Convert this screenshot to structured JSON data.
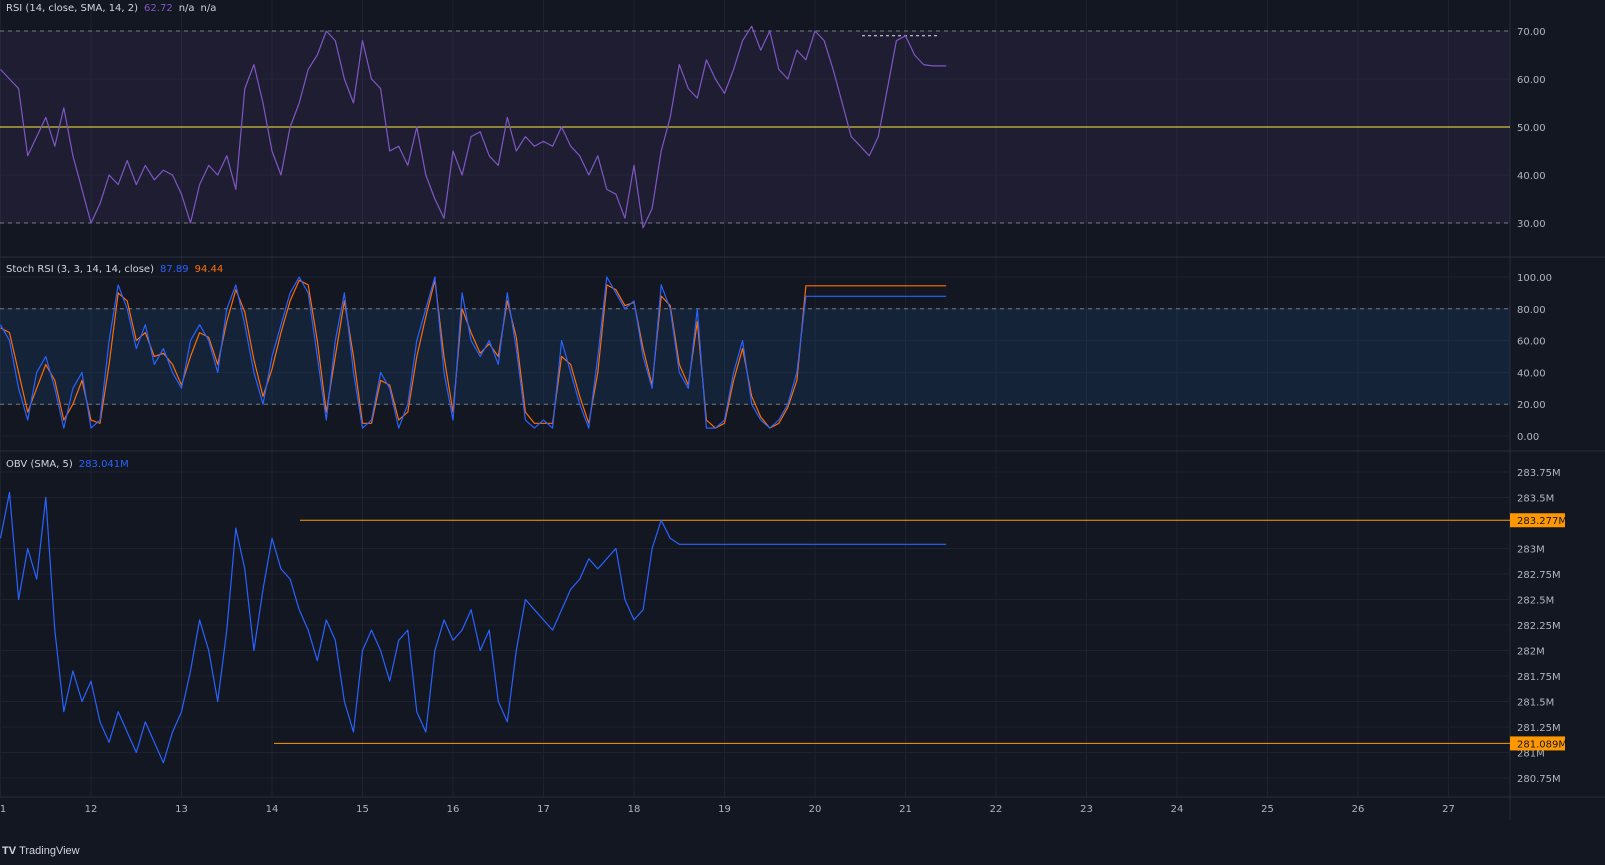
{
  "rsi": {
    "legend_name": "RSI (14, close, SMA, 14, 2)",
    "legend_value": "62.72",
    "legend_na1": "n/a",
    "legend_na2": "n/a",
    "ticks": [
      "70.00",
      "60.00",
      "50.00",
      "40.00",
      "30.00"
    ]
  },
  "stoch": {
    "legend_name": "Stoch RSI (3, 3, 14, 14, close)",
    "legend_k": "87.89",
    "legend_d": "94.44",
    "ticks": [
      "100.00",
      "80.00",
      "60.00",
      "40.00",
      "20.00",
      "0.00"
    ]
  },
  "obv": {
    "legend_name": "OBV (SMA, 5)",
    "legend_value": "283.041M",
    "ticks": [
      "283.75M",
      "283.5M",
      "283M",
      "282.75M",
      "282.5M",
      "282.25M",
      "282M",
      "281.75M",
      "281.5M",
      "281.25M",
      "281M",
      "280.75M"
    ],
    "level_high": "283.277M",
    "level_low": "281.089M"
  },
  "x_ticks": [
    "1",
    "12",
    "13",
    "14",
    "15",
    "16",
    "17",
    "18",
    "19",
    "20",
    "21",
    "22",
    "23",
    "24",
    "25",
    "26",
    "27"
  ],
  "brand": {
    "logo": "TV",
    "name": "TradingView"
  },
  "colors": {
    "background": "#131722",
    "rsi_line": "#7e57c2",
    "rsi_band": "#7e57c2",
    "rsi_mid_line": "#ffeb3b",
    "stoch_k": "#2962ff",
    "stoch_d": "#ff6d00",
    "stoch_band": "#2196f3",
    "obv_line": "#2962ff",
    "level_line": "#ff9800"
  },
  "chart_data": [
    {
      "type": "line",
      "title": "RSI (14, close, SMA, 14, 2)",
      "ylim": [
        27,
        73
      ],
      "guide_levels": [
        70,
        50,
        30
      ],
      "band": [
        30,
        70
      ],
      "x_range": [
        11,
        27.7
      ],
      "series": [
        {
          "name": "RSI",
          "x": [
            11.0,
            11.1,
            11.2,
            11.3,
            11.4,
            11.5,
            11.6,
            11.7,
            11.8,
            11.9,
            12.0,
            12.1,
            12.2,
            12.3,
            12.4,
            12.5,
            12.6,
            12.7,
            12.8,
            12.9,
            13.0,
            13.1,
            13.2,
            13.3,
            13.4,
            13.5,
            13.6,
            13.7,
            13.8,
            13.9,
            14.0,
            14.1,
            14.2,
            14.3,
            14.4,
            14.5,
            14.6,
            14.7,
            14.8,
            14.9,
            15.0,
            15.1,
            15.2,
            15.3,
            15.4,
            15.5,
            15.6,
            15.7,
            15.8,
            15.9,
            16.0,
            16.1,
            16.2,
            16.3,
            16.4,
            16.5,
            16.6,
            16.7,
            16.8,
            16.9,
            17.0,
            17.1,
            17.2,
            17.3,
            17.4,
            17.5,
            17.6,
            17.7,
            17.8,
            17.9,
            18.0,
            18.1,
            18.2,
            18.3,
            18.4,
            18.5,
            18.6,
            18.7,
            18.8,
            18.9,
            19.0,
            19.1,
            19.2,
            19.3,
            19.4,
            19.5,
            19.6,
            19.7,
            19.8,
            19.9,
            20.0,
            20.1,
            20.2,
            20.3,
            20.4,
            20.5,
            20.6,
            20.7,
            20.8,
            20.9,
            21.0,
            21.1,
            21.2,
            21.3,
            21.4,
            21.45
          ],
          "values": [
            62,
            60,
            58,
            44,
            48,
            52,
            46,
            54,
            44,
            37,
            30,
            34,
            40,
            38,
            43,
            38,
            42,
            39,
            41,
            40,
            36,
            30,
            38,
            42,
            40,
            44,
            37,
            58,
            63,
            55,
            45,
            40,
            50,
            55,
            62,
            65,
            70,
            68,
            60,
            55,
            68,
            60,
            58,
            45,
            46,
            42,
            50,
            40,
            35,
            31,
            45,
            40,
            48,
            49,
            44,
            42,
            52,
            45,
            48,
            46,
            47,
            46,
            50,
            46,
            44,
            40,
            44,
            37,
            36,
            31,
            42,
            29,
            33,
            45,
            52,
            63,
            58,
            56,
            64,
            60,
            57,
            62,
            68,
            71,
            66,
            70,
            62,
            60,
            66,
            64,
            70,
            68,
            62,
            55,
            48,
            46,
            44,
            48,
            58,
            68,
            69,
            65,
            63,
            62.72,
            62.72,
            62.72
          ]
        }
      ]
    },
    {
      "type": "line",
      "title": "Stoch RSI (3, 3, 14, 14, close)",
      "ylim": [
        -5,
        105
      ],
      "guide_levels": [
        80,
        20
      ],
      "band": [
        20,
        80
      ],
      "x_range": [
        11,
        27.7
      ],
      "series": [
        {
          "name": "K",
          "x": [
            11.0,
            11.1,
            11.2,
            11.3,
            11.4,
            11.5,
            11.6,
            11.7,
            11.8,
            11.9,
            12.0,
            12.1,
            12.2,
            12.3,
            12.4,
            12.5,
            12.6,
            12.7,
            12.8,
            12.9,
            13.0,
            13.1,
            13.2,
            13.3,
            13.4,
            13.5,
            13.6,
            13.7,
            13.8,
            13.9,
            14.0,
            14.1,
            14.2,
            14.3,
            14.4,
            14.5,
            14.6,
            14.7,
            14.8,
            14.9,
            15.0,
            15.1,
            15.2,
            15.3,
            15.4,
            15.5,
            15.6,
            15.7,
            15.8,
            15.9,
            16.0,
            16.1,
            16.2,
            16.3,
            16.4,
            16.5,
            16.6,
            16.7,
            16.8,
            16.9,
            17.0,
            17.1,
            17.2,
            17.3,
            17.4,
            17.5,
            17.6,
            17.7,
            17.8,
            17.9,
            18.0,
            18.1,
            18.2,
            18.3,
            18.4,
            18.5,
            18.6,
            18.7,
            18.8,
            18.9,
            19.0,
            19.1,
            19.2,
            19.3,
            19.4,
            19.5,
            19.6,
            19.7,
            19.8,
            19.9,
            20.0,
            20.1,
            20.2,
            20.3,
            20.4,
            20.5,
            20.6,
            20.7,
            20.8,
            20.9,
            21.0,
            21.1,
            21.2,
            21.3,
            21.4,
            21.45
          ],
          "values": [
            70,
            60,
            30,
            10,
            40,
            50,
            30,
            5,
            30,
            40,
            5,
            10,
            60,
            95,
            80,
            55,
            70,
            45,
            55,
            40,
            30,
            60,
            70,
            60,
            40,
            80,
            95,
            70,
            40,
            20,
            50,
            70,
            90,
            100,
            90,
            50,
            10,
            60,
            90,
            40,
            5,
            10,
            40,
            30,
            5,
            20,
            60,
            80,
            100,
            40,
            10,
            90,
            60,
            50,
            60,
            45,
            90,
            55,
            10,
            5,
            10,
            5,
            60,
            40,
            20,
            5,
            50,
            100,
            90,
            80,
            85,
            50,
            30,
            95,
            80,
            40,
            30,
            80,
            5,
            5,
            10,
            40,
            60,
            20,
            10,
            5,
            10,
            20,
            40,
            87.89,
            87.89,
            87.89,
            87.89,
            87.89,
            87.89,
            87.89,
            87.89,
            87.89,
            87.89,
            87.89,
            87.89,
            87.89,
            87.89,
            87.89,
            87.89,
            87.89
          ]
        },
        {
          "name": "D",
          "x": [
            11.0,
            11.1,
            11.2,
            11.3,
            11.4,
            11.5,
            11.6,
            11.7,
            11.8,
            11.9,
            12.0,
            12.1,
            12.2,
            12.3,
            12.4,
            12.5,
            12.6,
            12.7,
            12.8,
            12.9,
            13.0,
            13.1,
            13.2,
            13.3,
            13.4,
            13.5,
            13.6,
            13.7,
            13.8,
            13.9,
            14.0,
            14.1,
            14.2,
            14.3,
            14.4,
            14.5,
            14.6,
            14.7,
            14.8,
            14.9,
            15.0,
            15.1,
            15.2,
            15.3,
            15.4,
            15.5,
            15.6,
            15.7,
            15.8,
            15.9,
            16.0,
            16.1,
            16.2,
            16.3,
            16.4,
            16.5,
            16.6,
            16.7,
            16.8,
            16.9,
            17.0,
            17.1,
            17.2,
            17.3,
            17.4,
            17.5,
            17.6,
            17.7,
            17.8,
            17.9,
            18.0,
            18.1,
            18.2,
            18.3,
            18.4,
            18.5,
            18.6,
            18.7,
            18.8,
            18.9,
            19.0,
            19.1,
            19.2,
            19.3,
            19.4,
            19.5,
            19.6,
            19.7,
            19.8,
            19.9,
            20.0,
            20.1,
            20.2,
            20.3,
            20.4,
            20.5,
            20.6,
            20.7,
            20.8,
            20.9,
            21.0,
            21.1,
            21.2,
            21.3,
            21.4,
            21.45
          ],
          "values": [
            68,
            65,
            40,
            15,
            30,
            45,
            35,
            10,
            20,
            35,
            10,
            8,
            45,
            90,
            85,
            60,
            65,
            50,
            52,
            45,
            32,
            50,
            65,
            62,
            45,
            72,
            92,
            78,
            48,
            25,
            42,
            65,
            85,
            98,
            95,
            60,
            15,
            50,
            85,
            50,
            8,
            8,
            35,
            32,
            10,
            15,
            50,
            75,
            98,
            50,
            15,
            80,
            65,
            52,
            58,
            50,
            85,
            62,
            15,
            8,
            8,
            8,
            50,
            45,
            25,
            8,
            40,
            95,
            92,
            82,
            84,
            55,
            32,
            88,
            82,
            45,
            32,
            72,
            10,
            5,
            8,
            35,
            55,
            25,
            12,
            5,
            8,
            18,
            35,
            94.44,
            94.44,
            94.44,
            94.44,
            94.44,
            94.44,
            94.44,
            94.44,
            94.44,
            94.44,
            94.44,
            94.44,
            94.44,
            94.44,
            94.44,
            94.44,
            94.44
          ]
        }
      ]
    },
    {
      "type": "line",
      "title": "OBV (SMA, 5)",
      "ylim": [
        280.62,
        283.93
      ],
      "levels": [
        283.277,
        281.089
      ],
      "x_range": [
        11,
        27.7
      ],
      "series": [
        {
          "name": "OBV",
          "x": [
            11.0,
            11.1,
            11.2,
            11.3,
            11.4,
            11.5,
            11.6,
            11.7,
            11.8,
            11.9,
            12.0,
            12.1,
            12.2,
            12.3,
            12.4,
            12.5,
            12.6,
            12.7,
            12.8,
            12.9,
            13.0,
            13.1,
            13.2,
            13.3,
            13.4,
            13.5,
            13.6,
            13.7,
            13.8,
            13.9,
            14.0,
            14.1,
            14.2,
            14.3,
            14.4,
            14.5,
            14.6,
            14.7,
            14.8,
            14.9,
            15.0,
            15.1,
            15.2,
            15.3,
            15.4,
            15.5,
            15.6,
            15.7,
            15.8,
            15.9,
            16.0,
            16.1,
            16.2,
            16.3,
            16.4,
            16.5,
            16.6,
            16.7,
            16.8,
            16.9,
            17.0,
            17.1,
            17.2,
            17.3,
            17.4,
            17.5,
            17.6,
            17.7,
            17.8,
            17.9,
            18.0,
            18.1,
            18.2,
            18.3,
            18.4,
            18.5,
            18.6,
            18.7,
            18.8,
            18.9,
            19.0,
            19.1,
            19.2,
            19.3,
            19.4,
            19.5,
            19.6,
            19.7,
            19.8,
            19.9,
            20.0,
            20.1,
            20.2,
            20.3,
            20.4,
            20.5,
            20.6,
            20.7,
            20.8,
            20.9,
            21.0,
            21.1,
            21.2,
            21.3,
            21.4,
            21.45
          ],
          "values": [
            283.1,
            283.55,
            282.5,
            283.0,
            282.7,
            283.5,
            282.2,
            281.4,
            281.8,
            281.5,
            281.7,
            281.3,
            281.1,
            281.4,
            281.2,
            281.0,
            281.3,
            281.1,
            280.9,
            281.2,
            281.4,
            281.8,
            282.3,
            282.0,
            281.5,
            282.2,
            283.2,
            282.8,
            282.0,
            282.6,
            283.1,
            282.8,
            282.7,
            282.4,
            282.2,
            281.9,
            282.3,
            282.1,
            281.5,
            281.2,
            282.0,
            282.2,
            282.0,
            281.7,
            282.1,
            282.2,
            281.4,
            281.2,
            282.0,
            282.3,
            282.1,
            282.2,
            282.4,
            282.0,
            282.2,
            281.5,
            281.3,
            282.0,
            282.5,
            282.4,
            282.3,
            282.2,
            282.4,
            282.6,
            282.7,
            282.9,
            282.8,
            282.9,
            283.0,
            282.5,
            282.3,
            282.4,
            283.0,
            283.277,
            283.1,
            283.041,
            283.041,
            283.041,
            283.041,
            283.041,
            283.041,
            283.041,
            283.041,
            283.041,
            283.041,
            283.041,
            283.041,
            283.041,
            283.041,
            283.041,
            283.041,
            283.041,
            283.041,
            283.041,
            283.041,
            283.041,
            283.041,
            283.041,
            283.041,
            283.041,
            283.041,
            283.041,
            283.041,
            283.041,
            283.041,
            283.041
          ]
        }
      ]
    }
  ]
}
